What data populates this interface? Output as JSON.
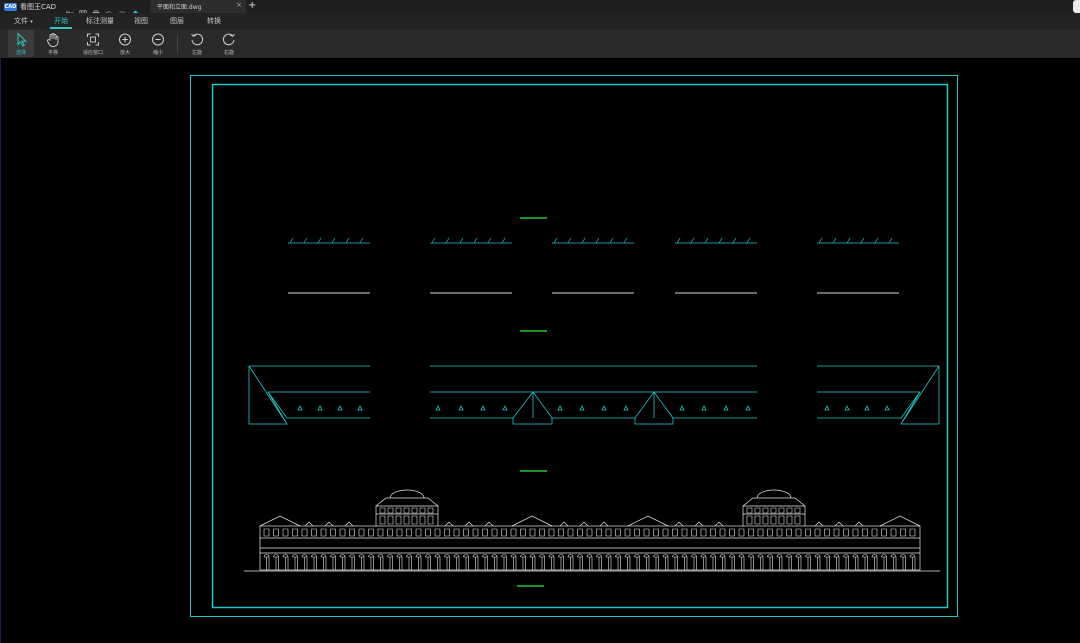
{
  "titlebar": {
    "logo_text": "CAD",
    "app_name": "看图王CAD",
    "document_tab": "平面和立面.dwg",
    "close_glyph": "×",
    "new_tab_glyph": "+"
  },
  "menu": {
    "items": [
      {
        "label": "文件",
        "dropdown": "▾"
      },
      {
        "label": "开始",
        "active": true
      },
      {
        "label": "标注测量"
      },
      {
        "label": "视图"
      },
      {
        "label": "图层"
      },
      {
        "label": "转换"
      }
    ]
  },
  "toolbar": {
    "tools": [
      {
        "label": "选择",
        "icon": "cursor-icon",
        "selected": true
      },
      {
        "label": "平移",
        "icon": "hand-icon"
      },
      {
        "label": "适应窗口",
        "icon": "fit-window-icon"
      },
      {
        "label": "放大",
        "icon": "zoom-in-icon"
      },
      {
        "label": "缩小",
        "icon": "zoom-out-icon"
      },
      {
        "label": "左旋",
        "icon": "rotate-left-icon"
      },
      {
        "label": "右旋",
        "icon": "rotate-right-icon"
      }
    ]
  },
  "colors": {
    "accent": "#2ec5c5",
    "frame": "#1fc9c9",
    "drawing_white": "#e6e6e6",
    "title_green": "#22c52f",
    "background": "#000000"
  }
}
